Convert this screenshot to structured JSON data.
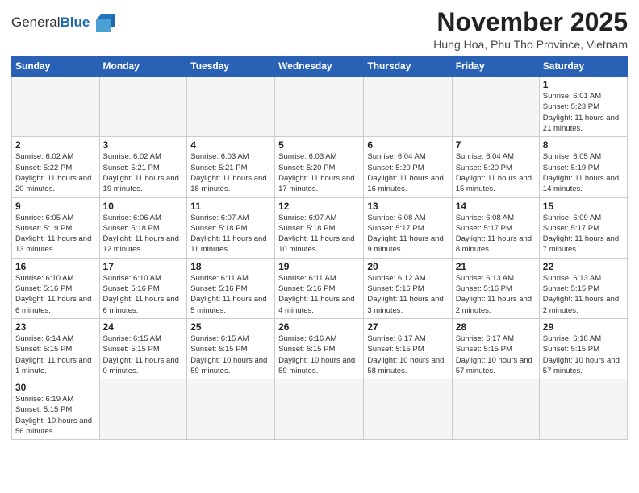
{
  "header": {
    "logo_general": "General",
    "logo_blue": "Blue",
    "title": "November 2025",
    "subtitle": "Hung Hoa, Phu Tho Province, Vietnam"
  },
  "weekdays": [
    "Sunday",
    "Monday",
    "Tuesday",
    "Wednesday",
    "Thursday",
    "Friday",
    "Saturday"
  ],
  "weeks": [
    [
      {
        "day": "",
        "info": ""
      },
      {
        "day": "",
        "info": ""
      },
      {
        "day": "",
        "info": ""
      },
      {
        "day": "",
        "info": ""
      },
      {
        "day": "",
        "info": ""
      },
      {
        "day": "",
        "info": ""
      },
      {
        "day": "1",
        "info": "Sunrise: 6:01 AM\nSunset: 5:23 PM\nDaylight: 11 hours\nand 21 minutes."
      }
    ],
    [
      {
        "day": "2",
        "info": "Sunrise: 6:02 AM\nSunset: 5:22 PM\nDaylight: 11 hours\nand 20 minutes."
      },
      {
        "day": "3",
        "info": "Sunrise: 6:02 AM\nSunset: 5:21 PM\nDaylight: 11 hours\nand 19 minutes."
      },
      {
        "day": "4",
        "info": "Sunrise: 6:03 AM\nSunset: 5:21 PM\nDaylight: 11 hours\nand 18 minutes."
      },
      {
        "day": "5",
        "info": "Sunrise: 6:03 AM\nSunset: 5:20 PM\nDaylight: 11 hours\nand 17 minutes."
      },
      {
        "day": "6",
        "info": "Sunrise: 6:04 AM\nSunset: 5:20 PM\nDaylight: 11 hours\nand 16 minutes."
      },
      {
        "day": "7",
        "info": "Sunrise: 6:04 AM\nSunset: 5:20 PM\nDaylight: 11 hours\nand 15 minutes."
      },
      {
        "day": "8",
        "info": "Sunrise: 6:05 AM\nSunset: 5:19 PM\nDaylight: 11 hours\nand 14 minutes."
      }
    ],
    [
      {
        "day": "9",
        "info": "Sunrise: 6:05 AM\nSunset: 5:19 PM\nDaylight: 11 hours\nand 13 minutes."
      },
      {
        "day": "10",
        "info": "Sunrise: 6:06 AM\nSunset: 5:18 PM\nDaylight: 11 hours\nand 12 minutes."
      },
      {
        "day": "11",
        "info": "Sunrise: 6:07 AM\nSunset: 5:18 PM\nDaylight: 11 hours\nand 11 minutes."
      },
      {
        "day": "12",
        "info": "Sunrise: 6:07 AM\nSunset: 5:18 PM\nDaylight: 11 hours\nand 10 minutes."
      },
      {
        "day": "13",
        "info": "Sunrise: 6:08 AM\nSunset: 5:17 PM\nDaylight: 11 hours\nand 9 minutes."
      },
      {
        "day": "14",
        "info": "Sunrise: 6:08 AM\nSunset: 5:17 PM\nDaylight: 11 hours\nand 8 minutes."
      },
      {
        "day": "15",
        "info": "Sunrise: 6:09 AM\nSunset: 5:17 PM\nDaylight: 11 hours\nand 7 minutes."
      }
    ],
    [
      {
        "day": "16",
        "info": "Sunrise: 6:10 AM\nSunset: 5:16 PM\nDaylight: 11 hours\nand 6 minutes."
      },
      {
        "day": "17",
        "info": "Sunrise: 6:10 AM\nSunset: 5:16 PM\nDaylight: 11 hours\nand 6 minutes."
      },
      {
        "day": "18",
        "info": "Sunrise: 6:11 AM\nSunset: 5:16 PM\nDaylight: 11 hours\nand 5 minutes."
      },
      {
        "day": "19",
        "info": "Sunrise: 6:11 AM\nSunset: 5:16 PM\nDaylight: 11 hours\nand 4 minutes."
      },
      {
        "day": "20",
        "info": "Sunrise: 6:12 AM\nSunset: 5:16 PM\nDaylight: 11 hours\nand 3 minutes."
      },
      {
        "day": "21",
        "info": "Sunrise: 6:13 AM\nSunset: 5:16 PM\nDaylight: 11 hours\nand 2 minutes."
      },
      {
        "day": "22",
        "info": "Sunrise: 6:13 AM\nSunset: 5:15 PM\nDaylight: 11 hours\nand 2 minutes."
      }
    ],
    [
      {
        "day": "23",
        "info": "Sunrise: 6:14 AM\nSunset: 5:15 PM\nDaylight: 11 hours\nand 1 minute."
      },
      {
        "day": "24",
        "info": "Sunrise: 6:15 AM\nSunset: 5:15 PM\nDaylight: 11 hours\nand 0 minutes."
      },
      {
        "day": "25",
        "info": "Sunrise: 6:15 AM\nSunset: 5:15 PM\nDaylight: 10 hours\nand 59 minutes."
      },
      {
        "day": "26",
        "info": "Sunrise: 6:16 AM\nSunset: 5:15 PM\nDaylight: 10 hours\nand 59 minutes."
      },
      {
        "day": "27",
        "info": "Sunrise: 6:17 AM\nSunset: 5:15 PM\nDaylight: 10 hours\nand 58 minutes."
      },
      {
        "day": "28",
        "info": "Sunrise: 6:17 AM\nSunset: 5:15 PM\nDaylight: 10 hours\nand 57 minutes."
      },
      {
        "day": "29",
        "info": "Sunrise: 6:18 AM\nSunset: 5:15 PM\nDaylight: 10 hours\nand 57 minutes."
      }
    ],
    [
      {
        "day": "30",
        "info": "Sunrise: 6:19 AM\nSunset: 5:15 PM\nDaylight: 10 hours\nand 56 minutes."
      },
      {
        "day": "",
        "info": ""
      },
      {
        "day": "",
        "info": ""
      },
      {
        "day": "",
        "info": ""
      },
      {
        "day": "",
        "info": ""
      },
      {
        "day": "",
        "info": ""
      },
      {
        "day": "",
        "info": ""
      }
    ]
  ]
}
